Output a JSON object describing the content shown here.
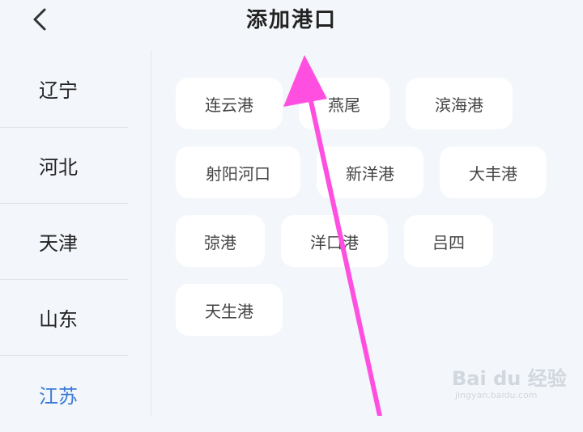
{
  "header": {
    "title": "添加港口"
  },
  "sidebar": {
    "items": [
      {
        "label": "辽宁"
      },
      {
        "label": "河北"
      },
      {
        "label": "天津"
      },
      {
        "label": "山东"
      },
      {
        "label": "江苏",
        "active": true
      }
    ]
  },
  "ports": [
    {
      "label": "连云港"
    },
    {
      "label": "燕尾"
    },
    {
      "label": "滨海港"
    },
    {
      "label": "射阳河口"
    },
    {
      "label": "新洋港"
    },
    {
      "label": "大丰港"
    },
    {
      "label": "弶港"
    },
    {
      "label": "洋口港"
    },
    {
      "label": "吕四"
    },
    {
      "label": "天生港"
    }
  ],
  "colors": {
    "accent": "#3a7bd5",
    "annotation_arrow": "#ff4fe0"
  },
  "watermark": {
    "brand": "Bai du 经验",
    "url": "jingyan.baidu.com"
  }
}
